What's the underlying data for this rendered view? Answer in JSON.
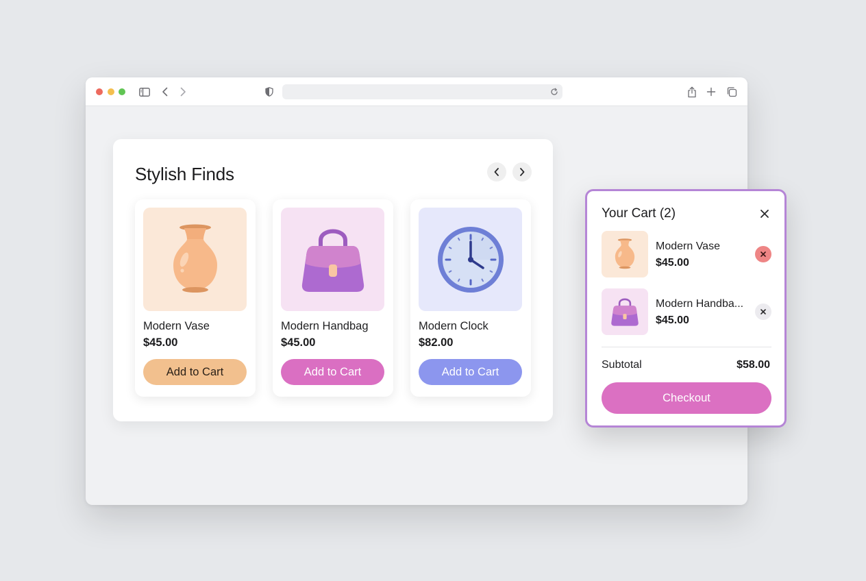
{
  "browser": {
    "url": ""
  },
  "carousel": {
    "title": "Stylish Finds",
    "prev_icon": "chevron-left-icon",
    "next_icon": "chevron-right-icon",
    "products": [
      {
        "name": "Modern Vase",
        "price": "$45.00",
        "button_label": "Add to Cart",
        "icon": "vase-icon",
        "bg": "#fbe8d8",
        "button_color": "#f2c08e",
        "button_text_color": "#2a2018"
      },
      {
        "name": "Modern Handbag",
        "price": "$45.00",
        "button_label": "Add to Cart",
        "icon": "handbag-icon",
        "bg": "#f6e2f3",
        "button_color": "#da6fc2",
        "button_text_color": "#ffffff"
      },
      {
        "name": "Modern Clock",
        "price": "$82.00",
        "button_label": "Add to Cart",
        "icon": "clock-icon",
        "bg": "#e6e8fb",
        "button_color": "#8c96ee",
        "button_text_color": "#ffffff"
      }
    ]
  },
  "cart": {
    "title": "Your Cart (2)",
    "items": [
      {
        "name": "Modern Vase",
        "price": "$45.00",
        "icon": "vase-icon",
        "remove_icon": "remove-icon"
      },
      {
        "name": "Modern Handba...",
        "price": "$45.00",
        "icon": "handbag-icon",
        "remove_icon": "remove-icon"
      }
    ],
    "subtotal_label": "Subtotal",
    "subtotal_value": "$58.00",
    "checkout_label": "Checkout",
    "colors": {
      "border": "#b585d6",
      "checkout": "#db70c2"
    }
  }
}
